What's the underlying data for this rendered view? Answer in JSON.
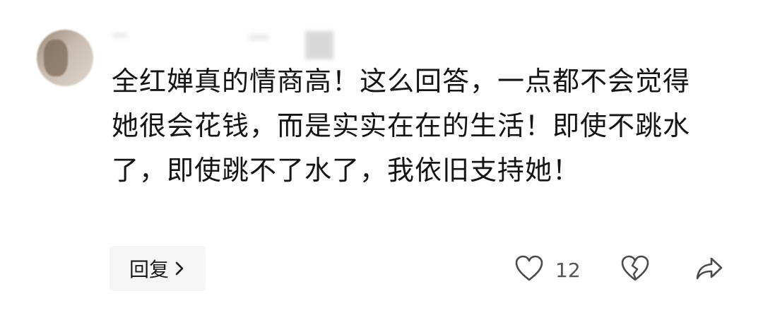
{
  "comment": {
    "text": "全红婵真的情商高！这么回答，一点都不会觉得她很会花钱，而是实实在在的生活！即使不跳水了，即使跳不了水了，我依旧支持她！",
    "avatar_icon": "user-avatar-blurred"
  },
  "actions": {
    "reply_label": "回复",
    "reply_icon": "chevron-right-icon",
    "like_icon": "heart-outline-icon",
    "like_count": "12",
    "dislike_icon": "broken-heart-icon",
    "share_icon": "share-arrow-icon"
  },
  "colors": {
    "text": "#141414",
    "muted": "#555555",
    "reply_bg": "#f6f6f6"
  }
}
